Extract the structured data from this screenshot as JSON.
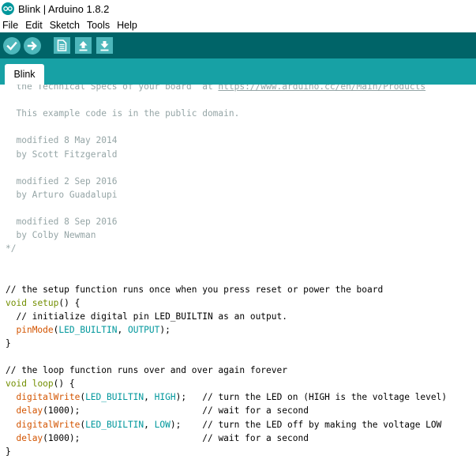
{
  "window": {
    "title": "Blink | Arduino 1.8.2"
  },
  "menubar": {
    "items": [
      "File",
      "Edit",
      "Sketch",
      "Tools",
      "Help"
    ]
  },
  "toolbar": {
    "buttons": [
      {
        "name": "verify",
        "icon": "checkmark-icon"
      },
      {
        "name": "upload",
        "icon": "right-arrow-icon"
      },
      {
        "name": "new",
        "icon": "new-file-icon"
      },
      {
        "name": "open",
        "icon": "up-arrow-icon"
      },
      {
        "name": "save",
        "icon": "down-arrow-icon"
      }
    ]
  },
  "tabs": [
    {
      "label": "Blink",
      "active": true
    }
  ],
  "colors": {
    "toolbar_bg": "#006468",
    "tabbar_bg": "#17a1a5",
    "button_bg": "#4db7bb",
    "comment": "#95a5a6",
    "keyword": "#728e00",
    "function": "#d35400",
    "constant": "#00979c"
  },
  "editor": {
    "lines": [
      [
        {
          "t": "  the Technical Specs of your board  at ",
          "c": "comment"
        },
        {
          "t": "https://www.arduino.cc/en/Main/Products",
          "c": "comment-link"
        }
      ],
      [],
      [
        {
          "t": "  This example code is in the public domain.",
          "c": "comment"
        }
      ],
      [],
      [
        {
          "t": "  modified 8 May 2014",
          "c": "comment"
        }
      ],
      [
        {
          "t": "  by Scott Fitzgerald",
          "c": "comment"
        }
      ],
      [],
      [
        {
          "t": "  modified 2 Sep 2016",
          "c": "comment"
        }
      ],
      [
        {
          "t": "  by Arturo Guadalupi",
          "c": "comment"
        }
      ],
      [],
      [
        {
          "t": "  modified 8 Sep 2016",
          "c": "comment"
        }
      ],
      [
        {
          "t": "  by Colby Newman",
          "c": "comment"
        }
      ],
      [
        {
          "t": "*/",
          "c": "comment"
        }
      ],
      [],
      [],
      [
        {
          "t": "// the setup function runs once when you press reset or power the board",
          "c": "plain"
        }
      ],
      [
        {
          "t": "void",
          "c": "kw"
        },
        {
          "t": " ",
          "c": "plain"
        },
        {
          "t": "setup",
          "c": "kw"
        },
        {
          "t": "() {",
          "c": "plain"
        }
      ],
      [
        {
          "t": "  // initialize digital pin LED_BUILTIN as an output.",
          "c": "plain"
        }
      ],
      [
        {
          "t": "  ",
          "c": "plain"
        },
        {
          "t": "pinMode",
          "c": "fn"
        },
        {
          "t": "(",
          "c": "plain"
        },
        {
          "t": "LED_BUILTIN",
          "c": "const"
        },
        {
          "t": ", ",
          "c": "plain"
        },
        {
          "t": "OUTPUT",
          "c": "const"
        },
        {
          "t": ");",
          "c": "plain"
        }
      ],
      [
        {
          "t": "}",
          "c": "plain"
        }
      ],
      [],
      [
        {
          "t": "// the loop function runs over and over again forever",
          "c": "plain"
        }
      ],
      [
        {
          "t": "void",
          "c": "kw"
        },
        {
          "t": " ",
          "c": "plain"
        },
        {
          "t": "loop",
          "c": "kw"
        },
        {
          "t": "() {",
          "c": "plain"
        }
      ],
      [
        {
          "t": "  ",
          "c": "plain"
        },
        {
          "t": "digitalWrite",
          "c": "fn"
        },
        {
          "t": "(",
          "c": "plain"
        },
        {
          "t": "LED_BUILTIN",
          "c": "const"
        },
        {
          "t": ", ",
          "c": "plain"
        },
        {
          "t": "HIGH",
          "c": "const"
        },
        {
          "t": ");   // turn the LED on (HIGH is the voltage level)",
          "c": "plain"
        }
      ],
      [
        {
          "t": "  ",
          "c": "plain"
        },
        {
          "t": "delay",
          "c": "fn"
        },
        {
          "t": "(1000);                       // wait for a second",
          "c": "plain"
        }
      ],
      [
        {
          "t": "  ",
          "c": "plain"
        },
        {
          "t": "digitalWrite",
          "c": "fn"
        },
        {
          "t": "(",
          "c": "plain"
        },
        {
          "t": "LED_BUILTIN",
          "c": "const"
        },
        {
          "t": ", ",
          "c": "plain"
        },
        {
          "t": "LOW",
          "c": "const"
        },
        {
          "t": ");    // turn the LED off by making the voltage LOW",
          "c": "plain"
        }
      ],
      [
        {
          "t": "  ",
          "c": "plain"
        },
        {
          "t": "delay",
          "c": "fn"
        },
        {
          "t": "(1000);                       // wait for a second",
          "c": "plain"
        }
      ],
      [
        {
          "t": "}",
          "c": "plain"
        }
      ]
    ]
  }
}
